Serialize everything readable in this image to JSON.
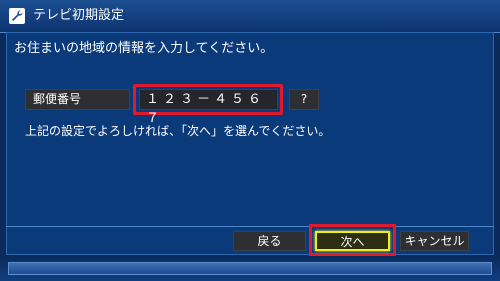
{
  "window": {
    "title": "テレビ初期設定",
    "icon": "wrench-icon"
  },
  "main": {
    "instruction": "お住まいの地域の情報を入力してください。",
    "postal_label": "郵便番号",
    "postal_value": "１２３－４５６７",
    "help_label": "?",
    "note": "上記の設定でよろしければ、「次へ」を選んでください。"
  },
  "buttons": {
    "back": "戻る",
    "next": "次へ",
    "cancel": "キャンセル"
  },
  "colors": {
    "background": "#0a2a5c",
    "highlight": "#e01a2c",
    "focus": "#f2ec1a"
  }
}
